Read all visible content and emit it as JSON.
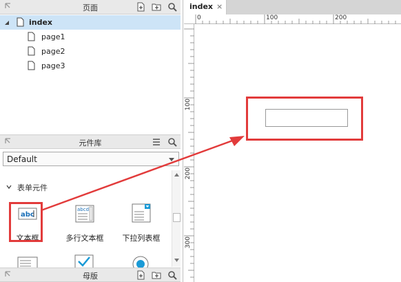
{
  "pages_panel": {
    "title": "页面",
    "pages": [
      {
        "label": "index",
        "selected": true
      },
      {
        "label": "page1"
      },
      {
        "label": "page2"
      },
      {
        "label": "page3"
      }
    ]
  },
  "widgets_panel": {
    "title": "元件库",
    "library": "Default",
    "section": "表单元件",
    "widgets": [
      {
        "label": "文本框",
        "icon": "text-field-icon",
        "highlighted": true
      },
      {
        "label": "多行文本框",
        "icon": "text-area-icon"
      },
      {
        "label": "下拉列表框",
        "icon": "droplist-icon"
      }
    ]
  },
  "masters_panel": {
    "title": "母版"
  },
  "editor": {
    "tab_label": "index",
    "tab_close": "×",
    "ruler_top": [
      "0",
      "100",
      "200"
    ],
    "ruler_left": [
      "100",
      "200",
      "300"
    ]
  },
  "colors": {
    "highlight": "#e23b3b",
    "selected_row": "#cde4f7",
    "accent": "#1a9ad6"
  }
}
